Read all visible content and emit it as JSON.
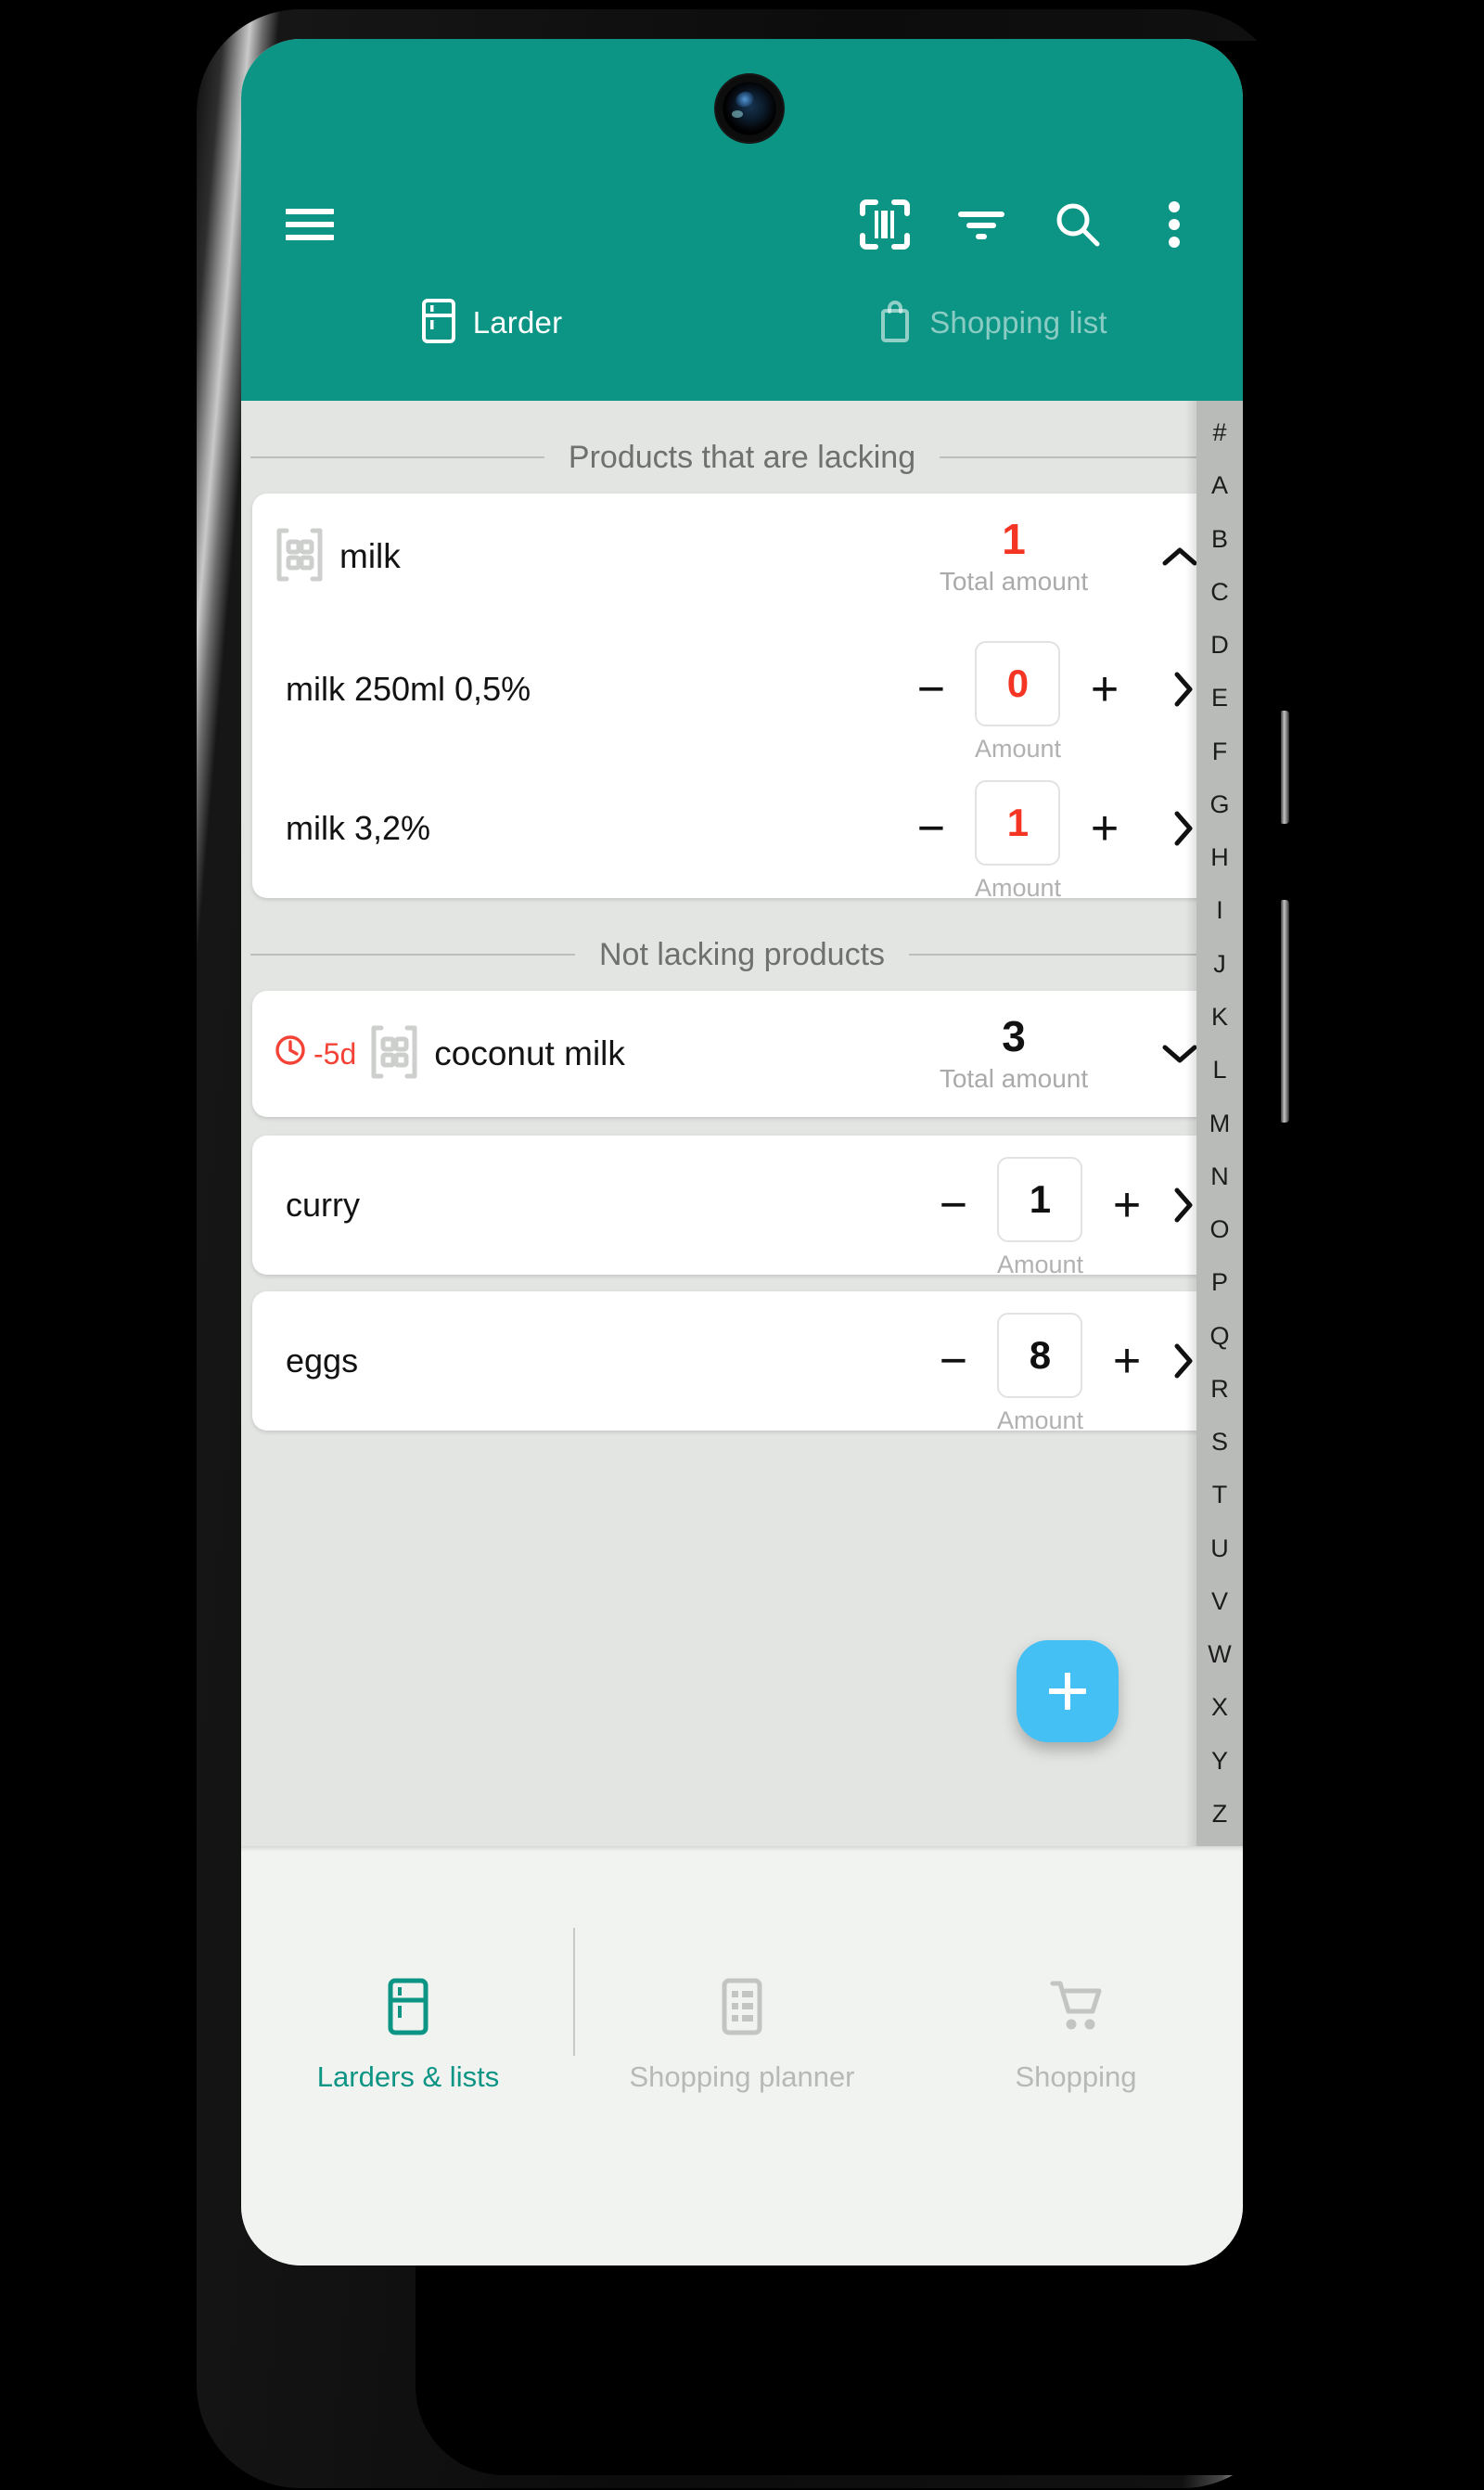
{
  "app_bar": {
    "color": "#0c9484",
    "menu_icon": "hamburger-menu-icon",
    "actions": [
      {
        "name": "barcode-scan-icon",
        "label": "Scan barcode"
      },
      {
        "name": "filter-icon",
        "label": "Filter"
      },
      {
        "name": "search-icon",
        "label": "Search"
      },
      {
        "name": "overflow-menu-icon",
        "label": "More options"
      }
    ]
  },
  "tabs": [
    {
      "label": "Larder",
      "icon": "fridge-icon",
      "active": true
    },
    {
      "label": "Shopping list",
      "icon": "shopping-bag-icon",
      "active": false
    }
  ],
  "sections": [
    {
      "title": "Products that are lacking",
      "groups": [
        {
          "icon": "product-group-icon",
          "name": "milk",
          "total_value": "1",
          "total_label": "Total amount",
          "total_state": "lacking",
          "expanded": true,
          "chevron": "chevron-up-icon",
          "items": [
            {
              "name": "milk 250ml 0,5%",
              "amount": "0",
              "amount_label": "Amount",
              "state": "lacking",
              "decrement": "−",
              "increment": "+",
              "chevron": "chevron-right-icon"
            },
            {
              "name": "milk 3,2%",
              "amount": "1",
              "amount_label": "Amount",
              "state": "lacking",
              "decrement": "−",
              "increment": "+",
              "chevron": "chevron-right-icon"
            }
          ]
        }
      ]
    },
    {
      "title": "Not lacking products",
      "groups": [
        {
          "icon": "product-group-icon",
          "name": "coconut milk",
          "total_value": "3",
          "total_label": "Total amount",
          "total_state": "ok",
          "expanded": false,
          "chevron": "chevron-down-icon",
          "expiry": {
            "icon": "clock-icon",
            "text": "-5d",
            "color": "#f44336"
          },
          "items": []
        }
      ],
      "standalone_items": [
        {
          "name": "curry",
          "amount": "1",
          "amount_label": "Amount",
          "state": "ok",
          "decrement": "−",
          "increment": "+",
          "chevron": "chevron-right-icon"
        },
        {
          "name": "eggs",
          "amount": "8",
          "amount_label": "Amount",
          "state": "ok",
          "decrement": "−",
          "increment": "+",
          "chevron": "chevron-right-icon"
        }
      ]
    }
  ],
  "alpha_index": [
    "#",
    "A",
    "B",
    "C",
    "D",
    "E",
    "F",
    "G",
    "H",
    "I",
    "J",
    "K",
    "L",
    "M",
    "N",
    "O",
    "P",
    "Q",
    "R",
    "S",
    "T",
    "U",
    "V",
    "W",
    "X",
    "Y",
    "Z"
  ],
  "fab": {
    "icon": "plus-icon",
    "color": "#45c0f5",
    "label": "+"
  },
  "bottom_nav": [
    {
      "label": "Larders & lists",
      "icon": "fridge-icon",
      "active": true
    },
    {
      "label": "Shopping planner",
      "icon": "list-document-icon",
      "active": false
    },
    {
      "label": "Shopping",
      "icon": "shopping-cart-icon",
      "active": false
    }
  ],
  "colors": {
    "accent_teal": "#0c9484",
    "lacking_red": "#f53524",
    "fab_blue": "#45c0f5",
    "background_gray": "#e3e5e3"
  }
}
